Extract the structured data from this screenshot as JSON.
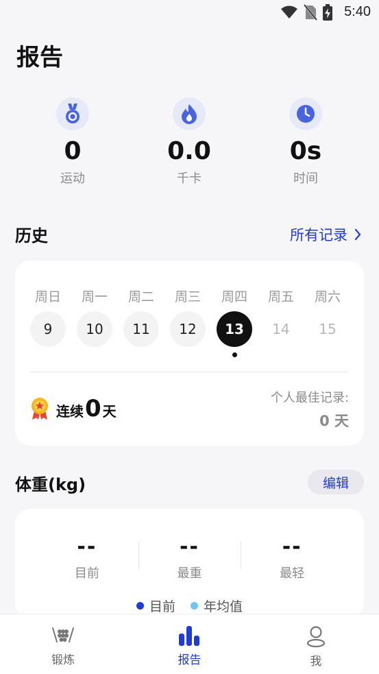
{
  "status": {
    "time": "5:40"
  },
  "page": {
    "title": "报告"
  },
  "stats": [
    {
      "value": "0",
      "label": "运动",
      "icon": "medal-icon"
    },
    {
      "value": "0.0",
      "label": "千卡",
      "icon": "flame-icon"
    },
    {
      "value": "0s",
      "label": "时间",
      "icon": "clock-icon"
    }
  ],
  "history": {
    "title": "历史",
    "all_records": "所有记录",
    "weekdays": [
      "周日",
      "周一",
      "周二",
      "周三",
      "周四",
      "周五",
      "周六"
    ],
    "dates": [
      "9",
      "10",
      "11",
      "12",
      "13",
      "14",
      "15"
    ],
    "active_index": 4,
    "streak_prefix": "连续",
    "streak_value": "0",
    "streak_suffix": "天",
    "best_label": "个人最佳记录:",
    "best_value": "0 天"
  },
  "weight": {
    "title": "体重(kg)",
    "edit_label": "编辑",
    "columns": [
      {
        "value": "--",
        "label": "目前"
      },
      {
        "value": "--",
        "label": "最重"
      },
      {
        "value": "--",
        "label": "最轻"
      }
    ],
    "legend": [
      {
        "label": "目前",
        "color": "#1f3dd3"
      },
      {
        "label": "年均值",
        "color": "#6fc3f7"
      }
    ]
  },
  "tabs": [
    {
      "label": "锻炼",
      "icon": "workout-icon",
      "active": false
    },
    {
      "label": "报告",
      "icon": "bar-chart-icon",
      "active": true
    },
    {
      "label": "我",
      "icon": "person-icon",
      "active": false
    }
  ],
  "colors": {
    "accent": "#1f3dd3",
    "icon_bg": "#e6e9f8",
    "icon_fg": "#4a63e0"
  }
}
